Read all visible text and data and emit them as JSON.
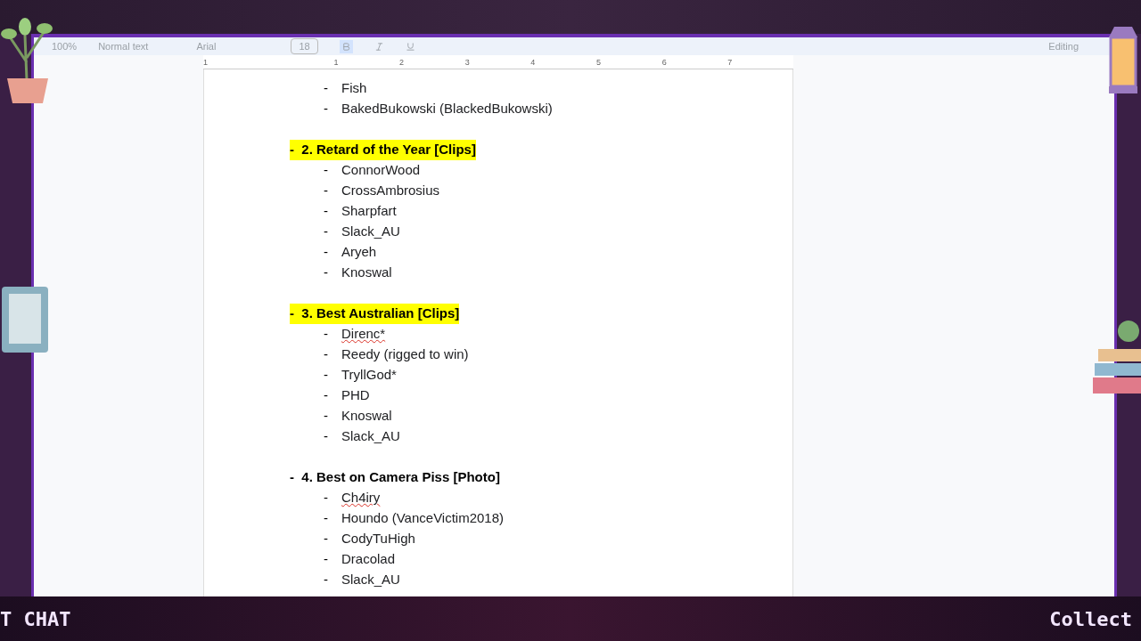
{
  "toolbar": {
    "zoom": "100%",
    "style": "Normal text",
    "font": "Arial",
    "size": "18",
    "mode": "Editing"
  },
  "ruler": {
    "labels": [
      "1",
      "1",
      "2",
      "3",
      "4",
      "5",
      "6",
      "7"
    ]
  },
  "document": {
    "leading_items": [
      {
        "bullet": "-",
        "text": "Fish",
        "flagged": false
      },
      {
        "bullet": "-",
        "text": "BakedBukowski (BlackedBukowski)",
        "flagged": false
      }
    ],
    "sections": [
      {
        "bullet": "-",
        "heading": "2. Retard of the Year [Clips]",
        "highlighted": true,
        "items": [
          {
            "bullet": "-",
            "text": "ConnorWood",
            "flagged": false
          },
          {
            "bullet": "-",
            "text": "CrossAmbrosius",
            "flagged": false
          },
          {
            "bullet": "-",
            "text": "Sharpfart",
            "flagged": false
          },
          {
            "bullet": "-",
            "text": "Slack_AU",
            "flagged": false
          },
          {
            "bullet": "-",
            "text": "Aryeh",
            "flagged": false
          },
          {
            "bullet": "-",
            "text": "Knoswal",
            "flagged": false
          }
        ]
      },
      {
        "bullet": "-",
        "heading": "3. Best Australian [Clips]",
        "highlighted": true,
        "items": [
          {
            "bullet": "-",
            "text": "Direnc*",
            "flagged": true
          },
          {
            "bullet": "-",
            "text": "Reedy (rigged to win)",
            "flagged": false
          },
          {
            "bullet": "-",
            "text": "TryllGod*",
            "flagged": false
          },
          {
            "bullet": "-",
            "text": "PHD",
            "flagged": false
          },
          {
            "bullet": "-",
            "text": "Knoswal",
            "flagged": false
          },
          {
            "bullet": "-",
            "text": "Slack_AU",
            "flagged": false
          }
        ]
      },
      {
        "bullet": "-",
        "heading": "4. Best on Camera Piss [Photo]",
        "highlighted": false,
        "items": [
          {
            "bullet": "-",
            "text": "Ch4iry",
            "flagged": true
          },
          {
            "bullet": "-",
            "text": "Houndo (VanceVictim2018)",
            "flagged": false
          },
          {
            "bullet": "-",
            "text": "CodyTuHigh",
            "flagged": false
          },
          {
            "bullet": "-",
            "text": "Dracolad",
            "flagged": false
          },
          {
            "bullet": "-",
            "text": "Slack_AU",
            "flagged": false
          }
        ]
      }
    ]
  },
  "bottom_bar": {
    "left": "T CHAT",
    "right": "Collect"
  }
}
